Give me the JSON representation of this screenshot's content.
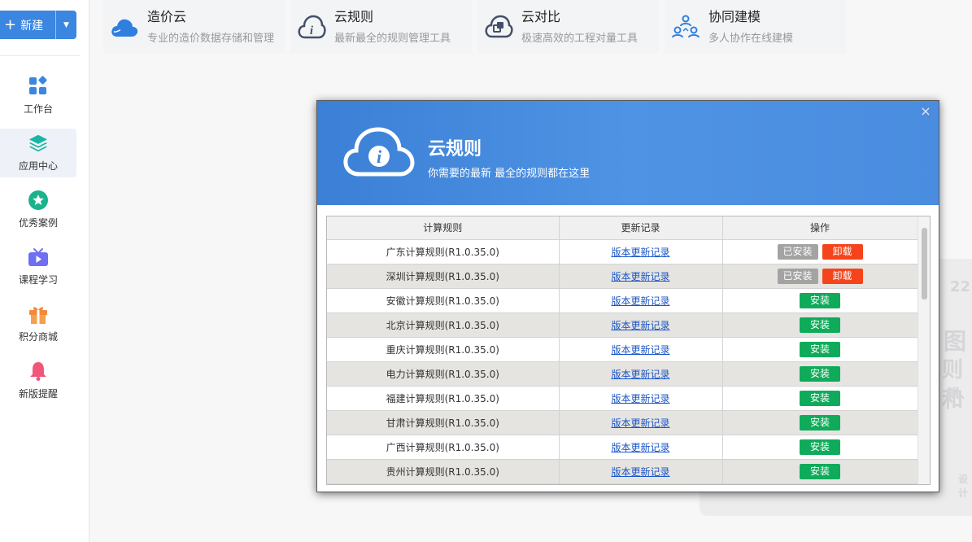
{
  "sidebar": {
    "new_label": "新建",
    "new_plus": "+",
    "new_caret": "▼",
    "items": [
      {
        "label": "工作台",
        "icon": "apps-grid-icon"
      },
      {
        "label": "应用中心",
        "icon": "layers-icon"
      },
      {
        "label": "优秀案例",
        "icon": "star-icon"
      },
      {
        "label": "课程学习",
        "icon": "tv-play-icon"
      },
      {
        "label": "积分商城",
        "icon": "gift-icon"
      },
      {
        "label": "新版提醒",
        "icon": "bell-icon"
      }
    ],
    "active_index": 1
  },
  "products": [
    {
      "name": "造价云",
      "desc": "专业的造价数据存储和管理",
      "icon": "cloud-icon"
    },
    {
      "name": "云规则",
      "desc": "最新最全的规则管理工具",
      "icon": "cloud-info-icon"
    },
    {
      "name": "云对比",
      "desc": "极速高效的工程对量工具",
      "icon": "cloud-compare-icon"
    },
    {
      "name": "协同建模",
      "desc": "多人协作在线建模",
      "icon": "team-icon"
    }
  ],
  "dialog": {
    "title": "云规则",
    "subtitle": "你需要的最新 最全的规则都在这里",
    "close": "×",
    "columns": [
      "计算规则",
      "更新记录",
      "操作"
    ],
    "rows": [
      {
        "rule": "广东计算规则(R1.0.35.0)",
        "log": "版本更新记录",
        "installed": true
      },
      {
        "rule": "深圳计算规则(R1.0.35.0)",
        "log": "版本更新记录",
        "installed": true
      },
      {
        "rule": "安徽计算规则(R1.0.35.0)",
        "log": "版本更新记录",
        "installed": false
      },
      {
        "rule": "北京计算规则(R1.0.35.0)",
        "log": "版本更新记录",
        "installed": false
      },
      {
        "rule": "重庆计算规则(R1.0.35.0)",
        "log": "版本更新记录",
        "installed": false
      },
      {
        "rule": "电力计算规则(R1.0.35.0)",
        "log": "版本更新记录",
        "installed": false
      },
      {
        "rule": "福建计算规则(R1.0.35.0)",
        "log": "版本更新记录",
        "installed": false
      },
      {
        "rule": "甘肃计算规则(R1.0.35.0)",
        "log": "版本更新记录",
        "installed": false
      },
      {
        "rule": "广西计算规则(R1.0.35.0)",
        "log": "版本更新记录",
        "installed": false
      },
      {
        "rule": "贵州计算规则(R1.0.35.0)",
        "log": "版本更新记录",
        "installed": false
      }
    ],
    "labels": {
      "installed": "已安装",
      "uninstall": "卸载",
      "install": "安装"
    }
  },
  "background": {
    "texts": [
      "22",
      "图",
      "则和",
      "辑、",
      "设计"
    ]
  },
  "colors": {
    "accent": "#3a86e0",
    "install": "#0fab5a",
    "uninstall": "#f5441c",
    "installed": "#a3a3a3"
  }
}
